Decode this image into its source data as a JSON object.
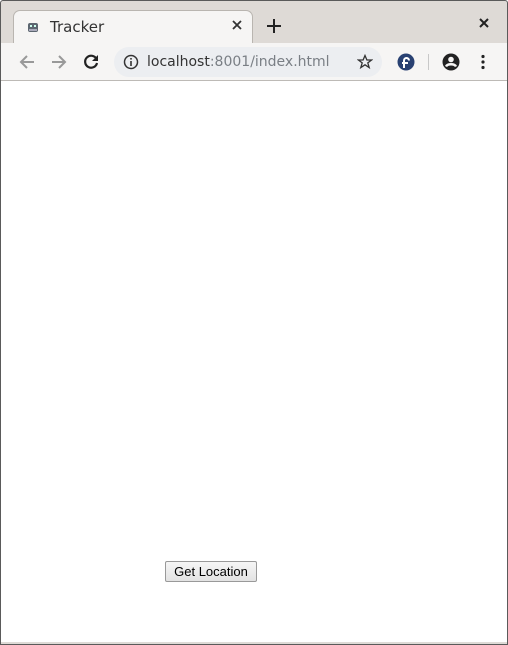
{
  "browser": {
    "tab": {
      "title": "Tracker",
      "favicon": "robot-favicon-icon"
    },
    "url": {
      "host": "localhost",
      "rest": ":8001/index.html"
    },
    "icons": [
      "back-icon",
      "forward-icon",
      "reload-icon",
      "info-icon",
      "star-icon",
      "fedora-extension-icon",
      "account-icon",
      "menu-icon"
    ]
  },
  "page": {
    "button_label": "Get Location"
  }
}
